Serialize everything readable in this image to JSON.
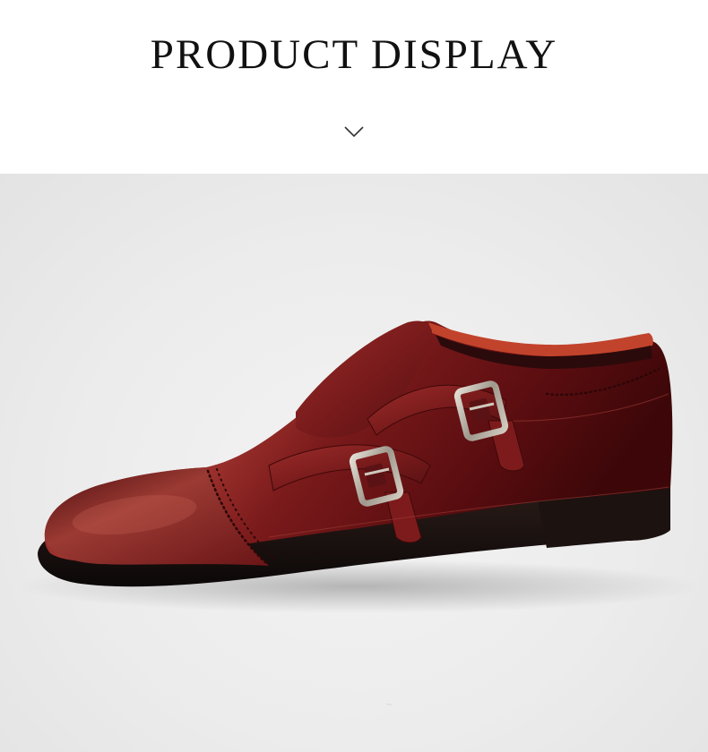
{
  "header": {
    "title": "PRODUCT DISPLAY"
  },
  "icons": {
    "chevron": "chevron-down-icon"
  },
  "product_image": {
    "subject": "shoe-photo",
    "colors": {
      "leather": "#6e1416",
      "highlight": "#b8473f",
      "sole": "#151010",
      "buckle": "#b9b3a9"
    }
  }
}
